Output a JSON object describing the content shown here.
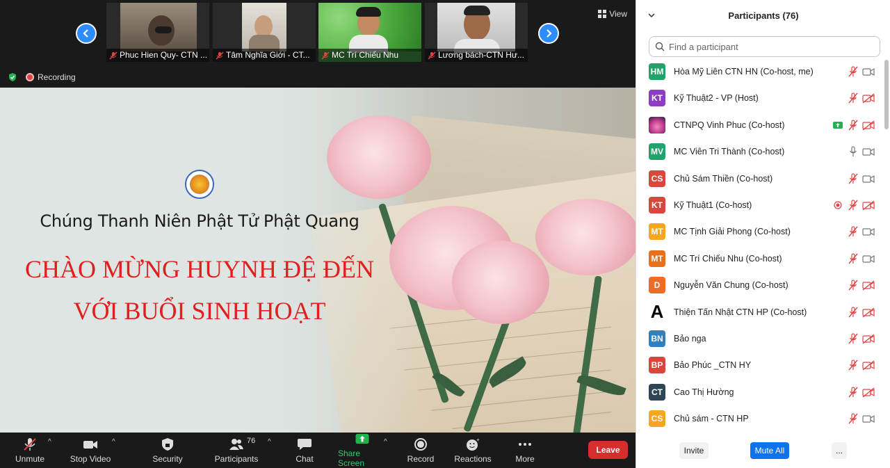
{
  "meeting": {
    "thumbnails": [
      {
        "name": "Phuc Hien Quy- CTN ...",
        "bg": "#8a7a6a"
      },
      {
        "name": "Tâm Nghĩa Giới - CT...",
        "bg": "#d9d4cc"
      },
      {
        "name": "MC Trí Chiếu Nhu",
        "bg": "#59b84a"
      },
      {
        "name": "Lương bách-CTN Hư...",
        "bg": "#cfcfcf"
      }
    ],
    "view_label": "View",
    "recording_label": "Recording"
  },
  "slide": {
    "org_title": "Chúng Thanh Niên Phật Tử Phật Quang",
    "welcome_line1": "CHÀO MỪNG HUYNH ĐỆ ĐẾN",
    "welcome_line2": "VỚI BUỔI SINH HOẠT"
  },
  "toolbar": {
    "unmute": "Unmute",
    "stop_video": "Stop Video",
    "security": "Security",
    "participants": "Participants",
    "participants_count": "76",
    "chat": "Chat",
    "share_screen": "Share Screen",
    "record": "Record",
    "reactions": "Reactions",
    "more": "More",
    "leave": "Leave"
  },
  "panel": {
    "title": "Participants (76)",
    "search_placeholder": "Find a participant",
    "participants": [
      {
        "initials": "HM",
        "name": "Hòa Mỹ Liên CTN HN (Co-host, me)",
        "color": "#23a36b",
        "mic": "muted",
        "cam": "on"
      },
      {
        "initials": "KT",
        "name": "Kỹ Thuật2 - VP (Host)",
        "color": "#8e3cc4",
        "mic": "muted",
        "cam": "off"
      },
      {
        "initials": "",
        "name": "CTNPQ Vinh Phuc (Co-host)",
        "color": "#7b2b6f",
        "mic": "muted",
        "cam": "off",
        "extra": "share"
      },
      {
        "initials": "MV",
        "name": "MC Viên Tri Thành (Co-host)",
        "color": "#23a36b",
        "mic": "on",
        "cam": "on"
      },
      {
        "initials": "CS",
        "name": "Chủ Sám Thiền (Co-host)",
        "color": "#d8473b",
        "mic": "muted",
        "cam": "on"
      },
      {
        "initials": "KT",
        "name": "Kỹ Thuật1 (Co-host)",
        "color": "#d8473b",
        "mic": "muted",
        "cam": "off",
        "extra": "record"
      },
      {
        "initials": "MT",
        "name": "MC Tịnh Giải Phong (Co-host)",
        "color": "#f5a623",
        "mic": "muted",
        "cam": "on"
      },
      {
        "initials": "MT",
        "name": "MC Trí Chiếu Nhu (Co-host)",
        "color": "#e6701e",
        "mic": "muted",
        "cam": "on"
      },
      {
        "initials": "D",
        "name": "Nguyễn Văn Chung (Co-host)",
        "color": "#f06b2a",
        "mic": "muted",
        "cam": "off"
      },
      {
        "initials": "A",
        "name": "Thiện Tấn Nhật CTN HP (Co-host)",
        "color": "#ffffff",
        "mic": "muted",
        "cam": "off",
        "letter_dark": true
      },
      {
        "initials": "BN",
        "name": "Bảo nga",
        "color": "#2f80c2",
        "mic": "muted",
        "cam": "off"
      },
      {
        "initials": "BP",
        "name": "Bảo Phúc _CTN HY",
        "color": "#d8473b",
        "mic": "muted",
        "cam": "off"
      },
      {
        "initials": "CT",
        "name": "Cao Thị Hường",
        "color": "#2e4553",
        "mic": "muted",
        "cam": "off"
      },
      {
        "initials": "CS",
        "name": "Chủ sám - CTN HP",
        "color": "#f5a623",
        "mic": "muted",
        "cam": "on"
      }
    ],
    "invite": "Invite",
    "mute_all": "Mute All",
    "more": "..."
  }
}
